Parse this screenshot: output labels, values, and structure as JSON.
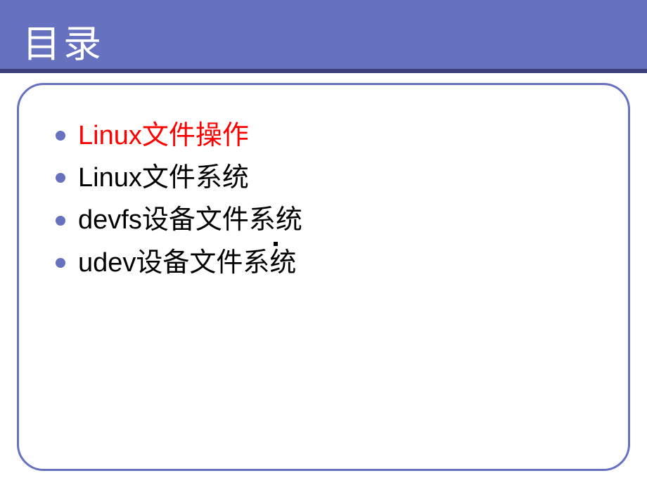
{
  "slide": {
    "title": "目录",
    "items": [
      {
        "text": "Linux文件操作",
        "highlighted": true
      },
      {
        "text": "Linux文件系统",
        "highlighted": false
      },
      {
        "text": "devfs设备文件系统",
        "highlighted": false
      },
      {
        "text": "udev设备文件系统",
        "highlighted": false
      }
    ]
  },
  "colors": {
    "accent": "#6671bf",
    "highlight": "#ff0000",
    "text": "#000000",
    "title_text": "#ffffff"
  }
}
